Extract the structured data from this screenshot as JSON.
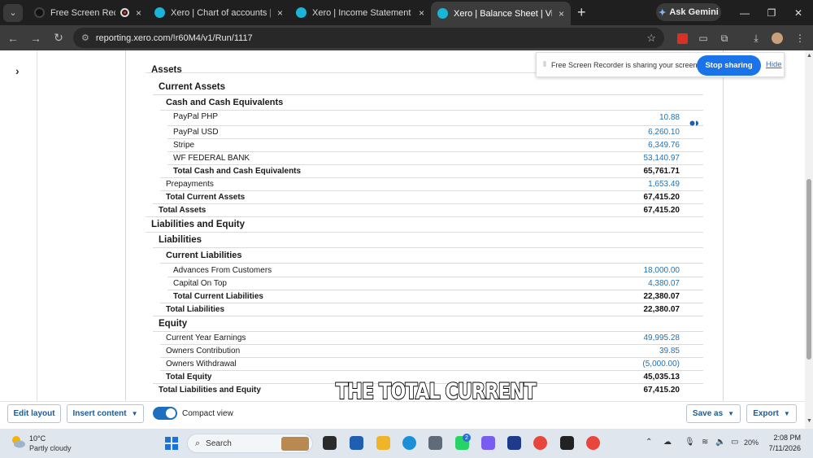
{
  "browser": {
    "tabs": [
      {
        "label": "Free Screen Recorder",
        "close": "×"
      },
      {
        "label": "Xero | Chart of accounts | Virtua",
        "close": "×"
      },
      {
        "label": "Xero | Income Statement (Profit",
        "close": "×"
      },
      {
        "label": "Xero | Balance Sheet | Virtual Cl",
        "close": "×"
      }
    ],
    "new_tab": "+",
    "gemini_label": "Ask Gemini",
    "url": "reporting.xero.com/!r60M4/v1/Run/1117"
  },
  "share_bar": {
    "message": "Free Screen Recorder is sharing your screen.",
    "stop_label": "Stop sharing",
    "hide_label": "Hide"
  },
  "report": {
    "assets_cut": "Assets",
    "current_assets": "Current Assets",
    "cash_header": "Cash and Cash Equivalents",
    "paypal_php": {
      "label": "PayPal PHP",
      "value": "10.88"
    },
    "paypal_usd": {
      "label": "PayPal USD",
      "value": "6,260.10"
    },
    "stripe": {
      "label": "Stripe",
      "value": "6,349.76"
    },
    "wf": {
      "label": "WF FEDERAL BANK",
      "value": "53,140.97"
    },
    "total_cash": {
      "label": "Total Cash and Cash Equivalents",
      "value": "65,761.71"
    },
    "prepayments": {
      "label": "Prepayments",
      "value": "1,653.49"
    },
    "total_current_assets": {
      "label": "Total Current Assets",
      "value": "67,415.20"
    },
    "total_assets": {
      "label": "Total Assets",
      "value": "67,415.20"
    },
    "liab_equity": "Liabilities and Equity",
    "liabilities": "Liabilities",
    "current_liabilities": "Current Liabilities",
    "advances": {
      "label": "Advances From Customers",
      "value": "18,000.00"
    },
    "capital": {
      "label": "Capital On Top",
      "value": "4,380.07"
    },
    "total_current_liab": {
      "label": "Total Current Liabilities",
      "value": "22,380.07"
    },
    "total_liabilities": {
      "label": "Total Liabilities",
      "value": "22,380.07"
    },
    "equity": "Equity",
    "cye": {
      "label": "Current Year Earnings",
      "value": "49,995.28"
    },
    "owners_contribution": {
      "label": "Owners Contribution",
      "value": "39.85"
    },
    "owners_withdrawal": {
      "label": "Owners Withdrawal",
      "value": "(5,000.00)"
    },
    "total_equity": {
      "label": "Total Equity",
      "value": "45,035.13"
    },
    "total_le": {
      "label": "Total Liabilities and Equity",
      "value": "67,415.20"
    }
  },
  "actions": {
    "edit_layout": "Edit layout",
    "insert_content": "Insert content",
    "compact_view": "Compact view",
    "save_as": "Save as",
    "export": "Export"
  },
  "caption": "THE TOTAL CURRENT",
  "taskbar": {
    "temp": "10°C",
    "condition": "Partly cloudy",
    "search_placeholder": "Search",
    "whatsapp_badge": "2",
    "battery": "20%",
    "time": "2:08 PM",
    "date": "7/11/2026"
  },
  "colors": {
    "accent": "#1a73e8",
    "link": "#1e72b8",
    "xero": "#1ab4d7"
  }
}
